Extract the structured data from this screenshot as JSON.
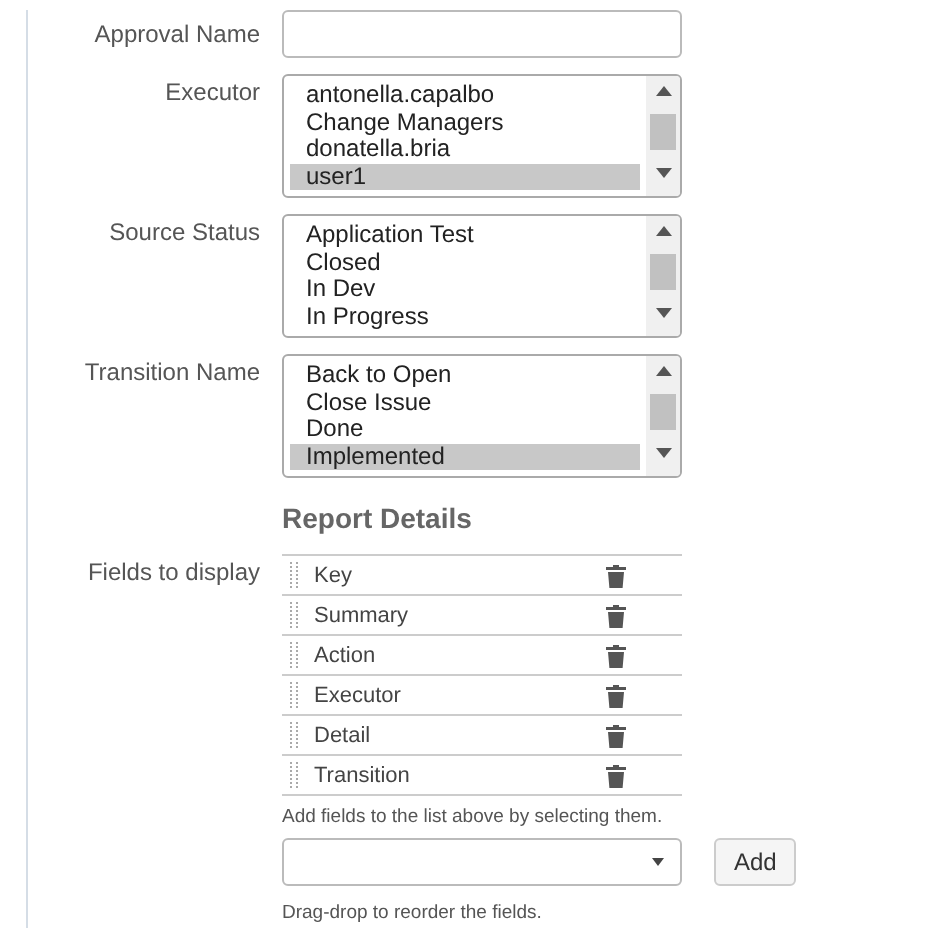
{
  "approval_name": {
    "label": "Approval Name"
  },
  "listboxes": [
    {
      "label": "Executor",
      "options": [
        {
          "text": "antonella.capalbo",
          "selected": false
        },
        {
          "text": "Change Managers",
          "selected": false
        },
        {
          "text": "donatella.bria",
          "selected": false
        },
        {
          "text": "user1",
          "selected": true
        }
      ]
    },
    {
      "label": "Source Status",
      "options": [
        {
          "text": "Application Test",
          "selected": false
        },
        {
          "text": "Closed",
          "selected": false
        },
        {
          "text": "In Dev",
          "selected": false
        },
        {
          "text": "In Progress",
          "selected": false
        }
      ]
    },
    {
      "label": "Transition Name",
      "options": [
        {
          "text": "Back to Open",
          "selected": false
        },
        {
          "text": "Close Issue",
          "selected": false
        },
        {
          "text": "Done",
          "selected": false
        },
        {
          "text": "Implemented",
          "selected": true
        }
      ]
    }
  ],
  "report_details": {
    "heading": "Report Details",
    "fields_label": "Fields to display",
    "fields": [
      "Key",
      "Summary",
      "Action",
      "Executor",
      "Detail",
      "Transition"
    ],
    "add_hint": "Add fields to the list above by selecting them.",
    "add_button": "Add",
    "reorder_hint": "Drag-drop to reorder the fields."
  }
}
